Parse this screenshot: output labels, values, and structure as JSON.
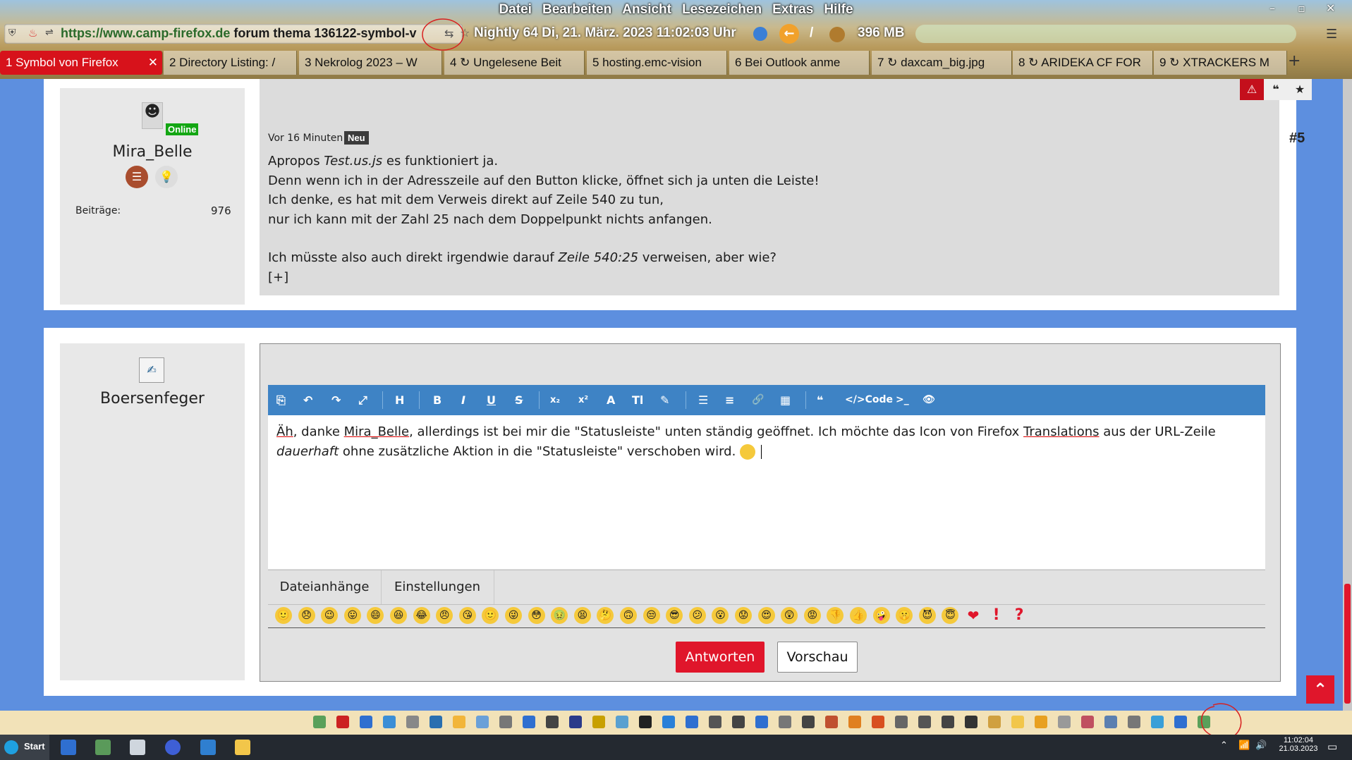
{
  "menu": [
    "Datei",
    "Bearbeiten",
    "Ansicht",
    "Lesezeichen",
    "Extras",
    "Hilfe"
  ],
  "window_controls": [
    "–",
    "▫",
    "✕"
  ],
  "url": {
    "scheme_host": "https://www.camp-firefox.de",
    "path1": "forum",
    "path2": "thema",
    "path3": "136122-symbol-v"
  },
  "status": {
    "date_time": "Nightly 64 Di, 21. März. 2023 11:02:03 Uhr",
    "memory": "396 MB",
    "back_glyph": "←",
    "slash": "/"
  },
  "tabs": [
    {
      "label": "1 Symbol von Firefox"
    },
    {
      "label": "2 Directory Listing: /"
    },
    {
      "label": "3 Nekrolog 2023 – W"
    },
    {
      "label": "4 ↻ Ungelesene Beit"
    },
    {
      "label": "5 hosting.emc-vision"
    },
    {
      "label": "6 Bei Outlook anme"
    },
    {
      "label": "7 ↻ daxcam_big.jpg"
    },
    {
      "label": "8 ↻ ARIDEKA CF FOR"
    },
    {
      "label": "9 ↻ XTRACKERS M"
    }
  ],
  "post1": {
    "author": "Mira_Belle",
    "online": "Online",
    "posts_label": "Beiträge:",
    "posts_count": "976",
    "time": "Vor 16 Minuten",
    "new_badge": "Neu",
    "number": "#5",
    "lines": [
      [
        "Apropos ",
        "Test.us.js",
        " es funktioniert ja."
      ],
      "Denn wenn ich in der Adresszeile auf den Button klicke, öffnet sich ja unten die Leiste!",
      "Ich denke, es hat mit dem Verweis direkt auf Zeile 540 zu tun,",
      "nur ich kann mit der Zahl 25 nach dem Doppelpunkt nichts anfangen.",
      [
        "Ich müsste also auch direkt irgendwie darauf ",
        "Zeile 540:25",
        " verweisen, aber wie?"
      ],
      "[+]"
    ]
  },
  "post2": {
    "author": "Boersenfeger",
    "toolbar": [
      "⎘",
      "↶",
      "↷",
      "⤢",
      "H",
      "B",
      "I",
      "U",
      "S",
      "x₂",
      "x²",
      "A",
      "Tl",
      "✎",
      "☰",
      "≡",
      "🔗",
      "▦",
      "❝",
      "</>Code",
      ">_",
      "👁"
    ],
    "editor_text": {
      "a": "Äh",
      "b": ", danke ",
      "c": "Mira_Belle",
      "d": ", allerdings ist bei mir die \"Statusleiste\" unten ständig geöffnet. Ich möchte das Icon von Firefox ",
      "e": "Translations",
      "f": " aus der URL-Zeile",
      "g": "dauerhaft",
      "h": " ohne zusätzliche Aktion in die \"Statusleiste\" verschoben wird. "
    },
    "tabs": [
      "Dateianhänge",
      "Einstellungen"
    ],
    "submit": "Antworten",
    "preview": "Vorschau",
    "emoji": [
      "🙂",
      "😞",
      "😉",
      "😛",
      "😄",
      "😆",
      "😂",
      "😠",
      "😘",
      "🙂",
      "😜",
      "😳",
      "🤢",
      "😫",
      "🤔",
      "🙃",
      "😒",
      "😎",
      "😕",
      "😮",
      "😟",
      "😍",
      "😲",
      "😡",
      "👎",
      "👍",
      "🤪",
      "🤫",
      "😈",
      "😇",
      "❤",
      "!",
      "?"
    ]
  },
  "taskbar": {
    "start": "Start",
    "time": "11:02:04",
    "date": "21.03.2023"
  },
  "colors": {
    "accent_red": "#e0162b",
    "toolbar_blue": "#3e83c5",
    "page_bg": "#5d8fdf"
  }
}
